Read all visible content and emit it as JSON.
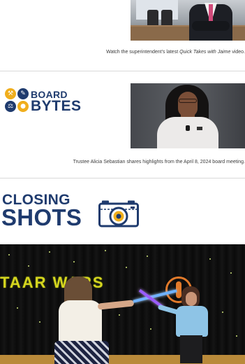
{
  "section_video": {
    "caption_prefix": "Watch the superintendent's latest ",
    "caption_italic": "Quick Takes with Jaime",
    "caption_suffix": " video."
  },
  "board_bytes": {
    "logo_word1": "BOARD",
    "logo_word2": "BYTES",
    "caption": "Trustee Alicia Sebastian shares highlights from the April 8, 2024 board meeting."
  },
  "closing_shots": {
    "word1": "CLOSING",
    "word2": "SHOTS"
  },
  "photo": {
    "banner_text": "TAAR WARS"
  },
  "icons": {
    "camera": "camera-icon",
    "board_bytes_badges": [
      "gavel-icon",
      "pen-icon",
      "scales-icon",
      "bulb-icon"
    ]
  },
  "colors": {
    "brand_navy": "#1f3b6e",
    "brand_gold": "#f0ae1c"
  }
}
